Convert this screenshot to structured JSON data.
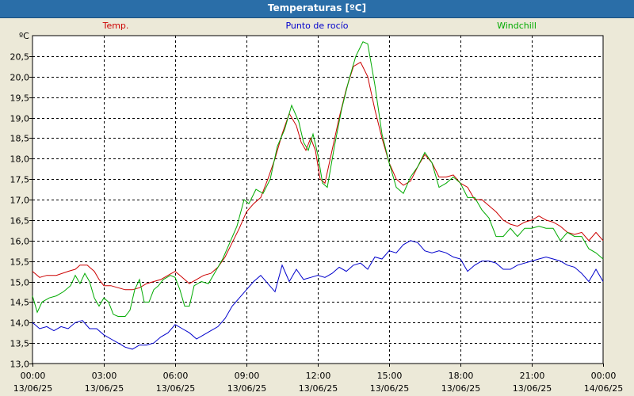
{
  "window": {
    "title": "Temperaturas [ºC]"
  },
  "chart_data": {
    "type": "line",
    "title": "Temperaturas [ºC]",
    "ylabel": "ºC",
    "ylim": [
      13.0,
      21.0
    ],
    "yticks": [
      13.0,
      13.5,
      14.0,
      14.5,
      15.0,
      15.5,
      16.0,
      16.5,
      17.0,
      17.5,
      18.0,
      18.5,
      19.0,
      19.5,
      20.0,
      20.5
    ],
    "ytick_labels": [
      "13,0",
      "13,5",
      "14,0",
      "14,5",
      "15,0",
      "15,5",
      "16,0",
      "16,5",
      "17,0",
      "17,5",
      "18,0",
      "18,5",
      "19,0",
      "19,5",
      "20,0",
      "20,5"
    ],
    "xlim": [
      0,
      24
    ],
    "xticks": [
      {
        "h": 0,
        "time": "00:00",
        "date": "13/06/25"
      },
      {
        "h": 3,
        "time": "03:00",
        "date": "13/06/25"
      },
      {
        "h": 6,
        "time": "06:00",
        "date": "13/06/25"
      },
      {
        "h": 9,
        "time": "09:00",
        "date": "13/06/25"
      },
      {
        "h": 12,
        "time": "12:00",
        "date": "13/06/25"
      },
      {
        "h": 15,
        "time": "15:00",
        "date": "13/06/25"
      },
      {
        "h": 18,
        "time": "18:00",
        "date": "13/06/25"
      },
      {
        "h": 21,
        "time": "21:00",
        "date": "13/06/25"
      },
      {
        "h": 24,
        "time": "00:00",
        "date": "14/06/25"
      }
    ],
    "grid": true,
    "legend_position": "top",
    "series": [
      {
        "name": "Temp.",
        "color": "#cc0000",
        "points": [
          [
            0,
            15.25
          ],
          [
            0.3,
            15.1
          ],
          [
            0.6,
            15.15
          ],
          [
            1,
            15.15
          ],
          [
            1.5,
            15.25
          ],
          [
            1.8,
            15.3
          ],
          [
            2,
            15.4
          ],
          [
            2.3,
            15.4
          ],
          [
            2.6,
            15.25
          ],
          [
            2.8,
            15.05
          ],
          [
            3,
            14.9
          ],
          [
            3.3,
            14.9
          ],
          [
            3.6,
            14.85
          ],
          [
            3.9,
            14.8
          ],
          [
            4.2,
            14.8
          ],
          [
            4.5,
            14.85
          ],
          [
            4.8,
            14.95
          ],
          [
            5.1,
            15.0
          ],
          [
            5.4,
            15.05
          ],
          [
            5.7,
            15.15
          ],
          [
            6,
            15.25
          ],
          [
            6.3,
            15.1
          ],
          [
            6.6,
            14.95
          ],
          [
            6.9,
            15.05
          ],
          [
            7.2,
            15.15
          ],
          [
            7.5,
            15.2
          ],
          [
            7.8,
            15.35
          ],
          [
            8.1,
            15.6
          ],
          [
            8.4,
            15.95
          ],
          [
            8.7,
            16.3
          ],
          [
            9,
            16.7
          ],
          [
            9.3,
            16.9
          ],
          [
            9.6,
            17.05
          ],
          [
            9.9,
            17.5
          ],
          [
            10.2,
            18.0
          ],
          [
            10.5,
            18.6
          ],
          [
            10.8,
            19.1
          ],
          [
            11.1,
            18.8
          ],
          [
            11.3,
            18.4
          ],
          [
            11.5,
            18.2
          ],
          [
            11.7,
            18.5
          ],
          [
            11.9,
            18.2
          ],
          [
            12.1,
            17.5
          ],
          [
            12.3,
            17.4
          ],
          [
            12.6,
            18.2
          ],
          [
            12.9,
            19.0
          ],
          [
            13.2,
            19.7
          ],
          [
            13.5,
            20.25
          ],
          [
            13.8,
            20.35
          ],
          [
            14.1,
            20.0
          ],
          [
            14.4,
            19.2
          ],
          [
            14.7,
            18.5
          ],
          [
            15,
            17.9
          ],
          [
            15.3,
            17.5
          ],
          [
            15.6,
            17.35
          ],
          [
            15.9,
            17.45
          ],
          [
            16.2,
            17.8
          ],
          [
            16.5,
            18.1
          ],
          [
            16.8,
            17.9
          ],
          [
            17.1,
            17.55
          ],
          [
            17.4,
            17.55
          ],
          [
            17.7,
            17.6
          ],
          [
            18,
            17.4
          ],
          [
            18.3,
            17.3
          ],
          [
            18.6,
            17.0
          ],
          [
            18.9,
            17.0
          ],
          [
            19.2,
            16.85
          ],
          [
            19.5,
            16.7
          ],
          [
            19.8,
            16.5
          ],
          [
            20.1,
            16.4
          ],
          [
            20.4,
            16.35
          ],
          [
            20.7,
            16.45
          ],
          [
            21,
            16.5
          ],
          [
            21.3,
            16.6
          ],
          [
            21.6,
            16.5
          ],
          [
            21.9,
            16.45
          ],
          [
            22.2,
            16.35
          ],
          [
            22.5,
            16.2
          ],
          [
            22.8,
            16.15
          ],
          [
            23.1,
            16.2
          ],
          [
            23.4,
            16.0
          ],
          [
            23.7,
            16.2
          ],
          [
            24,
            16.0
          ]
        ]
      },
      {
        "name": "Punto de rocío",
        "color": "#0000cc",
        "points": [
          [
            0,
            14.0
          ],
          [
            0.3,
            13.85
          ],
          [
            0.6,
            13.9
          ],
          [
            0.9,
            13.8
          ],
          [
            1.2,
            13.9
          ],
          [
            1.5,
            13.85
          ],
          [
            1.8,
            14.0
          ],
          [
            2.1,
            14.05
          ],
          [
            2.4,
            13.85
          ],
          [
            2.7,
            13.85
          ],
          [
            3,
            13.7
          ],
          [
            3.3,
            13.6
          ],
          [
            3.6,
            13.5
          ],
          [
            3.9,
            13.4
          ],
          [
            4.2,
            13.35
          ],
          [
            4.5,
            13.45
          ],
          [
            4.8,
            13.45
          ],
          [
            5.1,
            13.5
          ],
          [
            5.4,
            13.65
          ],
          [
            5.7,
            13.75
          ],
          [
            6,
            13.95
          ],
          [
            6.3,
            13.85
          ],
          [
            6.6,
            13.75
          ],
          [
            6.9,
            13.6
          ],
          [
            7.2,
            13.7
          ],
          [
            7.5,
            13.8
          ],
          [
            7.8,
            13.9
          ],
          [
            8.1,
            14.1
          ],
          [
            8.4,
            14.4
          ],
          [
            8.7,
            14.6
          ],
          [
            9,
            14.8
          ],
          [
            9.3,
            15.0
          ],
          [
            9.6,
            15.15
          ],
          [
            9.9,
            14.95
          ],
          [
            10.2,
            14.75
          ],
          [
            10.5,
            15.4
          ],
          [
            10.8,
            15.0
          ],
          [
            11.1,
            15.3
          ],
          [
            11.4,
            15.05
          ],
          [
            11.7,
            15.1
          ],
          [
            12,
            15.15
          ],
          [
            12.3,
            15.1
          ],
          [
            12.6,
            15.2
          ],
          [
            12.9,
            15.35
          ],
          [
            13.2,
            15.25
          ],
          [
            13.5,
            15.4
          ],
          [
            13.8,
            15.45
          ],
          [
            14.1,
            15.3
          ],
          [
            14.4,
            15.6
          ],
          [
            14.7,
            15.55
          ],
          [
            15,
            15.75
          ],
          [
            15.3,
            15.7
          ],
          [
            15.6,
            15.9
          ],
          [
            15.9,
            16.0
          ],
          [
            16.2,
            15.95
          ],
          [
            16.5,
            15.75
          ],
          [
            16.8,
            15.7
          ],
          [
            17.1,
            15.75
          ],
          [
            17.4,
            15.7
          ],
          [
            17.7,
            15.6
          ],
          [
            18,
            15.55
          ],
          [
            18.3,
            15.25
          ],
          [
            18.6,
            15.4
          ],
          [
            18.9,
            15.5
          ],
          [
            19.2,
            15.5
          ],
          [
            19.5,
            15.45
          ],
          [
            19.8,
            15.3
          ],
          [
            20.1,
            15.3
          ],
          [
            20.4,
            15.4
          ],
          [
            20.7,
            15.45
          ],
          [
            21,
            15.5
          ],
          [
            21.3,
            15.55
          ],
          [
            21.6,
            15.6
          ],
          [
            21.9,
            15.55
          ],
          [
            22.2,
            15.5
          ],
          [
            22.5,
            15.4
          ],
          [
            22.8,
            15.35
          ],
          [
            23.1,
            15.2
          ],
          [
            23.4,
            15.0
          ],
          [
            23.7,
            15.3
          ],
          [
            24,
            15.0
          ]
        ]
      },
      {
        "name": "Windchill",
        "color": "#00aa00",
        "points": [
          [
            0,
            14.65
          ],
          [
            0.2,
            14.25
          ],
          [
            0.4,
            14.5
          ],
          [
            0.7,
            14.6
          ],
          [
            1,
            14.65
          ],
          [
            1.3,
            14.75
          ],
          [
            1.6,
            14.9
          ],
          [
            1.8,
            15.15
          ],
          [
            2,
            14.95
          ],
          [
            2.2,
            15.2
          ],
          [
            2.4,
            15.0
          ],
          [
            2.6,
            14.6
          ],
          [
            2.8,
            14.4
          ],
          [
            3,
            14.6
          ],
          [
            3.2,
            14.5
          ],
          [
            3.4,
            14.2
          ],
          [
            3.6,
            14.15
          ],
          [
            3.9,
            14.15
          ],
          [
            4.1,
            14.3
          ],
          [
            4.3,
            14.8
          ],
          [
            4.5,
            15.05
          ],
          [
            4.7,
            14.5
          ],
          [
            4.9,
            14.5
          ],
          [
            5.1,
            14.8
          ],
          [
            5.3,
            14.9
          ],
          [
            5.5,
            15.05
          ],
          [
            5.8,
            15.15
          ],
          [
            6,
            15.1
          ],
          [
            6.2,
            14.8
          ],
          [
            6.4,
            14.4
          ],
          [
            6.6,
            14.4
          ],
          [
            6.8,
            14.9
          ],
          [
            7.1,
            15.0
          ],
          [
            7.4,
            14.95
          ],
          [
            7.7,
            15.25
          ],
          [
            8,
            15.55
          ],
          [
            8.3,
            15.95
          ],
          [
            8.6,
            16.35
          ],
          [
            8.9,
            17.0
          ],
          [
            9.1,
            16.9
          ],
          [
            9.4,
            17.25
          ],
          [
            9.7,
            17.15
          ],
          [
            10,
            17.5
          ],
          [
            10.3,
            18.3
          ],
          [
            10.6,
            18.7
          ],
          [
            10.9,
            19.3
          ],
          [
            11.2,
            18.9
          ],
          [
            11.4,
            18.4
          ],
          [
            11.6,
            18.2
          ],
          [
            11.8,
            18.6
          ],
          [
            12,
            18.1
          ],
          [
            12.2,
            17.4
          ],
          [
            12.4,
            17.3
          ],
          [
            12.7,
            18.3
          ],
          [
            13,
            19.2
          ],
          [
            13.3,
            19.9
          ],
          [
            13.6,
            20.5
          ],
          [
            13.9,
            20.85
          ],
          [
            14.1,
            20.8
          ],
          [
            14.4,
            19.8
          ],
          [
            14.7,
            18.6
          ],
          [
            15,
            17.9
          ],
          [
            15.3,
            17.3
          ],
          [
            15.6,
            17.15
          ],
          [
            15.9,
            17.55
          ],
          [
            16.2,
            17.8
          ],
          [
            16.5,
            18.15
          ],
          [
            16.8,
            17.9
          ],
          [
            17.1,
            17.3
          ],
          [
            17.4,
            17.4
          ],
          [
            17.7,
            17.55
          ],
          [
            18,
            17.4
          ],
          [
            18.3,
            17.05
          ],
          [
            18.6,
            17.05
          ],
          [
            18.9,
            16.75
          ],
          [
            19.2,
            16.55
          ],
          [
            19.5,
            16.1
          ],
          [
            19.8,
            16.1
          ],
          [
            20.1,
            16.3
          ],
          [
            20.4,
            16.1
          ],
          [
            20.7,
            16.3
          ],
          [
            21,
            16.3
          ],
          [
            21.3,
            16.35
          ],
          [
            21.6,
            16.3
          ],
          [
            21.9,
            16.3
          ],
          [
            22.2,
            16.0
          ],
          [
            22.5,
            16.2
          ],
          [
            22.8,
            16.1
          ],
          [
            23.1,
            16.1
          ],
          [
            23.4,
            15.8
          ],
          [
            23.7,
            15.7
          ],
          [
            24,
            15.55
          ]
        ]
      }
    ]
  }
}
